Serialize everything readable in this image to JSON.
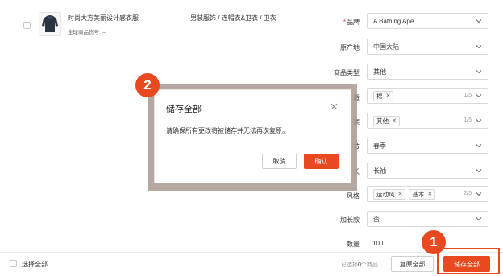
{
  "product": {
    "name": "时尚大方美丽设计感衣服",
    "global_id_label": "全球商品货号: --",
    "category_path": "男装服饰 / 连帽衣&卫衣 / 卫衣",
    "thumbnail_icon": "hoodie-icon"
  },
  "attributes": [
    {
      "label": "品牌",
      "required": true,
      "value": "A Bathing Ape",
      "tags": [],
      "count": ""
    },
    {
      "label": "原产地",
      "required": false,
      "value": "中国大陆",
      "tags": [],
      "count": ""
    },
    {
      "label": "商品类型",
      "required": false,
      "value": "其他",
      "tags": [],
      "count": ""
    },
    {
      "label": "适",
      "required": false,
      "value": "",
      "tags": [
        "棉"
      ],
      "count": "1/5"
    },
    {
      "label": "案",
      "required": false,
      "value": "",
      "tags": [
        "其他"
      ],
      "count": "1/5"
    },
    {
      "label": "节",
      "required": false,
      "value": "春季",
      "tags": [],
      "count": ""
    },
    {
      "label": "长",
      "required": false,
      "value": "长袖",
      "tags": [],
      "count": ""
    },
    {
      "label": "风格",
      "required": false,
      "value": "",
      "tags": [
        "运动风",
        "基本"
      ],
      "count": "2/5"
    },
    {
      "label": "加长款",
      "required": false,
      "value": "否",
      "tags": [],
      "count": ""
    }
  ],
  "quantity": {
    "label": "数量",
    "value": "100"
  },
  "footer": {
    "select_all": "选择全部",
    "selected_prefix": "已选择",
    "selected_count": "0",
    "selected_suffix": "个商品",
    "restore_all": "复原全部",
    "save_all": "储存全部"
  },
  "modal": {
    "title": "储存全部",
    "body": "请确保所有更改将被储存并无法再次复原。",
    "cancel": "取消",
    "confirm": "确认"
  },
  "callouts": {
    "one": "1",
    "two": "2"
  },
  "colors": {
    "accent": "#e8491f",
    "required": "#e4393c"
  }
}
